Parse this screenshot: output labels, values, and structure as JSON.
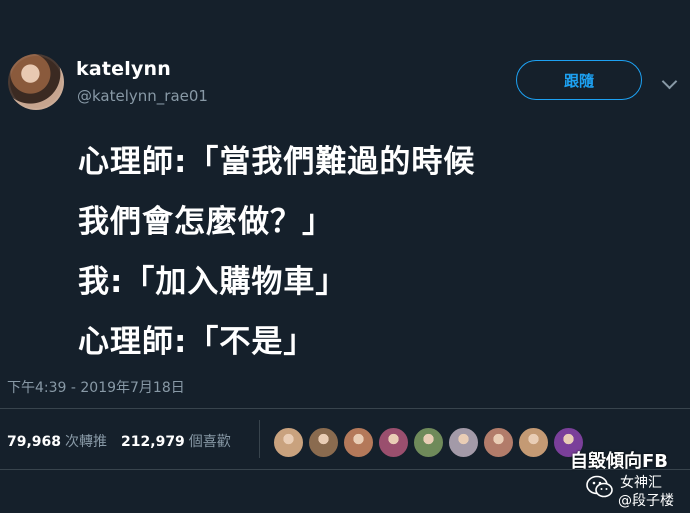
{
  "header": {
    "display_name": "katelynn",
    "handle": "@katelynn_rae01",
    "follow_label": "跟隨"
  },
  "tweet": {
    "lines": [
      "心理師:「當我們難過的時候",
      "我們會怎麼做？」",
      "我:「加入購物車」",
      "心理師:「不是」"
    ],
    "timestamp": "下午4:39 - 2019年7月18日"
  },
  "stats": {
    "retweets_count": "79,968",
    "retweets_label": "次轉推",
    "likes_count": "212,979",
    "likes_label": "個喜歡"
  },
  "likers": [
    {
      "color": "#c9a27e"
    },
    {
      "color": "#8a6b4f"
    },
    {
      "color": "#b4795a"
    },
    {
      "color": "#9a4f6e"
    },
    {
      "color": "#6f8a5a"
    },
    {
      "color": "#a39aa8"
    },
    {
      "color": "#b27c6a"
    },
    {
      "color": "#c49a74"
    },
    {
      "color": "#7a3f9a"
    }
  ],
  "watermark": {
    "line1": "自毀傾向FB",
    "line2": "女神汇",
    "line3": "@段子楼"
  },
  "colors": {
    "background": "#15202b",
    "accent": "#1da1f2",
    "muted": "#8899a6",
    "divider": "#38444d"
  }
}
